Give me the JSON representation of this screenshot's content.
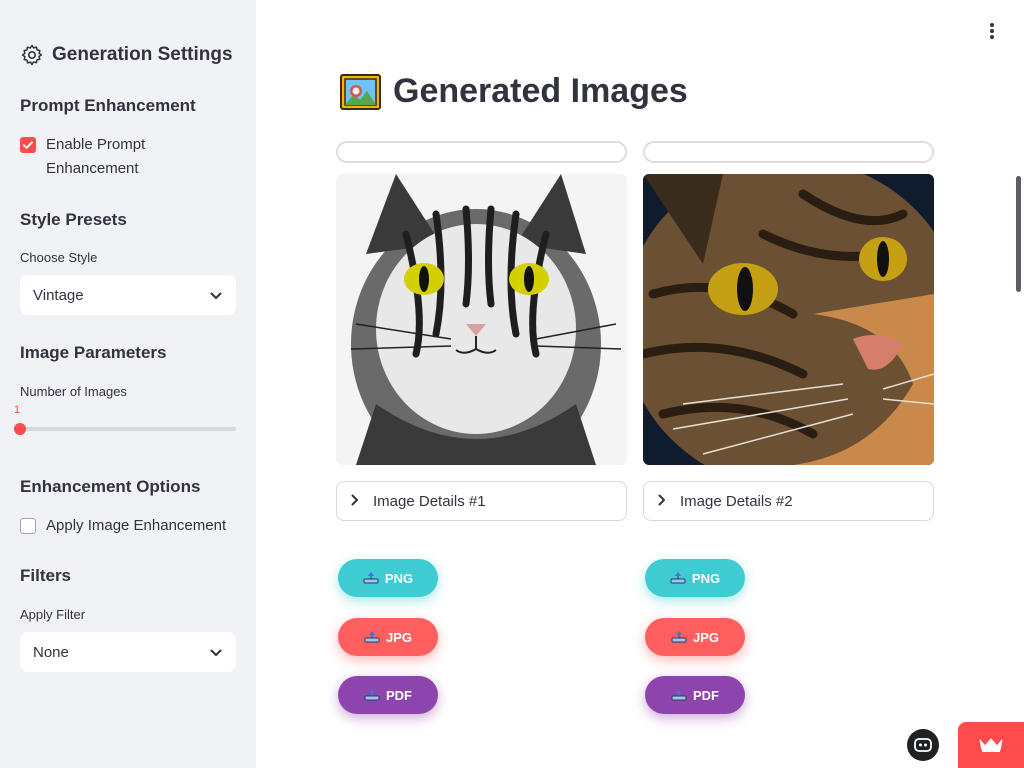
{
  "sidebar": {
    "title": "Generation Settings",
    "title_icon": "gear-icon",
    "prompt_enhancement": {
      "heading": "Prompt Enhancement",
      "checkbox_label_line1": "Enable Prompt",
      "checkbox_label_line2": "Enhancement",
      "checked": true
    },
    "style_presets": {
      "heading": "Style Presets",
      "select_label": "Choose Style",
      "selected": "Vintage"
    },
    "image_parameters": {
      "heading": "Image Parameters",
      "slider_label": "Number of Images",
      "slider_value": "1"
    },
    "enhancement_options": {
      "heading": "Enhancement Options",
      "checkbox_label": "Apply Image Enhancement",
      "checked": false
    },
    "filters": {
      "heading": "Filters",
      "select_label": "Apply Filter",
      "selected": "None"
    }
  },
  "main": {
    "title": "Generated Images",
    "title_icon": "framed-picture-icon",
    "images": [
      {
        "details_label": "Image Details #1",
        "buttons": {
          "png": "PNG",
          "jpg": "JPG",
          "pdf": "PDF"
        }
      },
      {
        "details_label": "Image Details #2",
        "buttons": {
          "png": "PNG",
          "jpg": "JPG",
          "pdf": "PDF"
        }
      }
    ]
  },
  "colors": {
    "accent": "#ff4b4b",
    "png": "#3ecbd1",
    "jpg": "#ff5f5f",
    "pdf": "#8e44ad",
    "sidebar_bg": "#f0f2f6"
  }
}
